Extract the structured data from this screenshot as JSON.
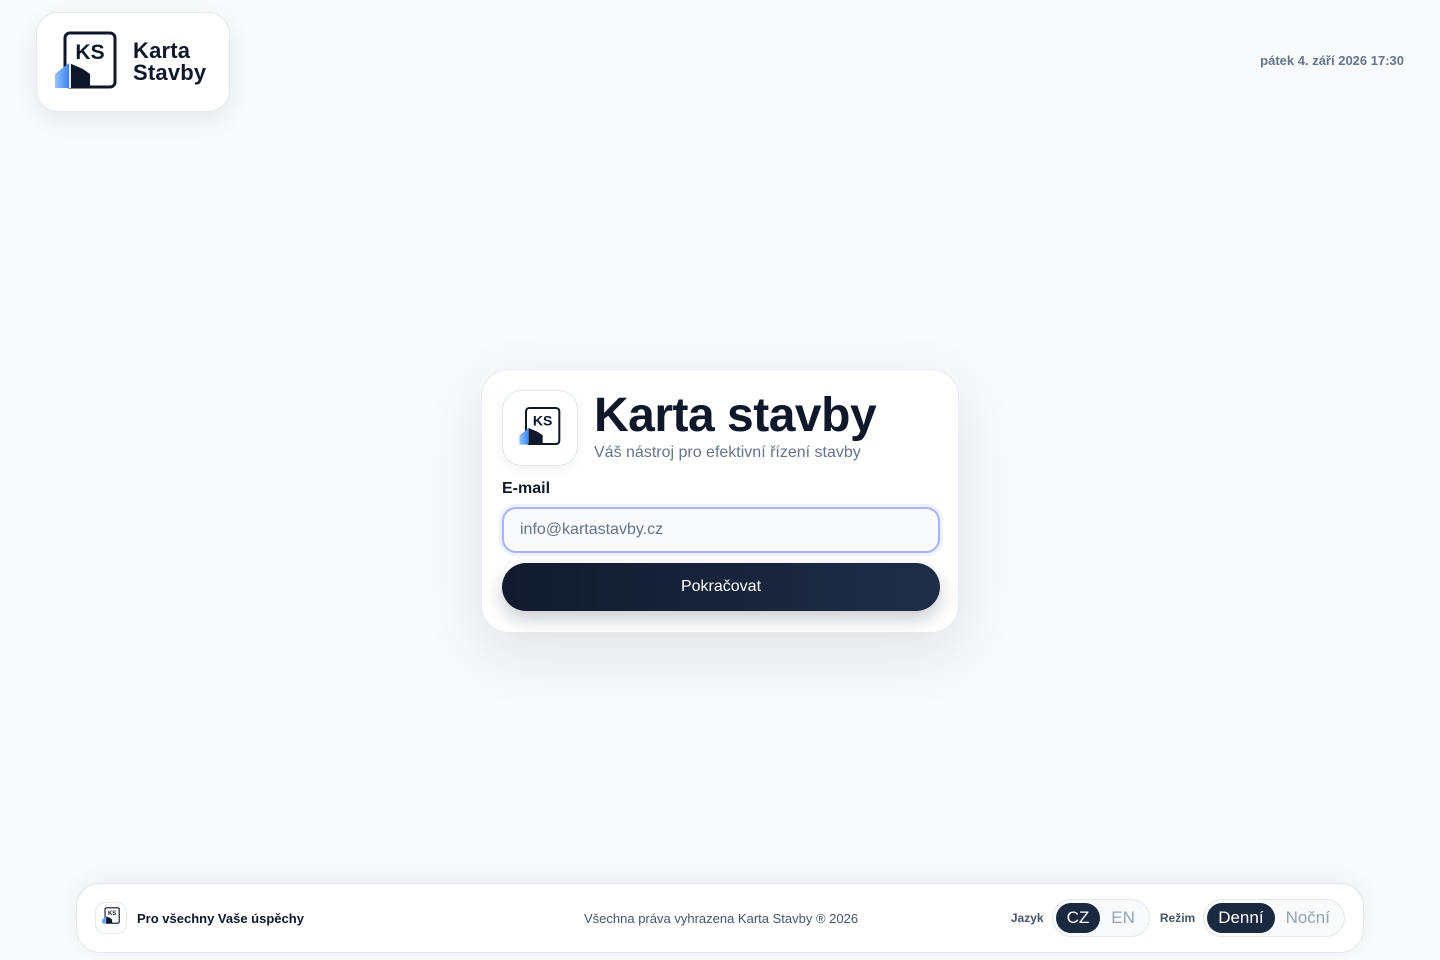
{
  "brand": {
    "logo_text": "KS",
    "name_line1": "Karta",
    "name_line2": "Stavby"
  },
  "header": {
    "datetime": "pátek 4. září 2026 17:30"
  },
  "login": {
    "title": "Karta stavby",
    "subtitle": "Váš nástroj pro efektivní řízení stavby",
    "email_label": "E-mail",
    "email_placeholder": "info@kartastavby.cz",
    "email_value": "",
    "continue_label": "Pokračovat"
  },
  "footer": {
    "tagline": "Pro všechny Vaše úspěchy",
    "copyright": "Všechna práva vyhrazena Karta Stavby ® 2026",
    "language_label": "Jazyk",
    "language_options": [
      "CZ",
      "EN"
    ],
    "language_selected": "CZ",
    "mode_label": "Režim",
    "mode_options": [
      "Denní",
      "Noční"
    ],
    "mode_selected": "Denní"
  },
  "colors": {
    "background": "#f8fafc",
    "primary_dark": "#0f172a",
    "accent_blue": "#60a5fa",
    "input_focus": "#a5b4fc",
    "muted_text": "#64748b"
  },
  "icons": {
    "logo": "ks-building-logo-icon"
  }
}
